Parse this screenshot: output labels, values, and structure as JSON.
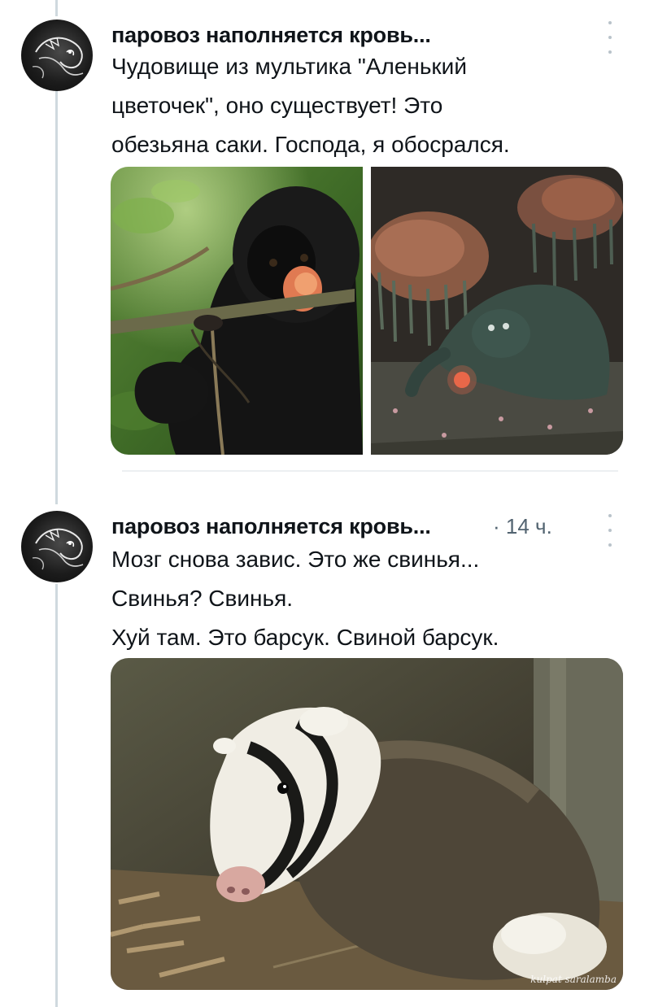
{
  "tweets": [
    {
      "author": "паровоз наполняется кровь...",
      "time": "",
      "text_lines": [
        "Чудовище из мультика \"Аленький",
        "цветочек\", оно существует! Это",
        "обезьяна саки. Господа, я обосрался."
      ],
      "media": [
        {
          "name": "photo-saki-monkey"
        },
        {
          "name": "still-cartoon-beast"
        }
      ]
    },
    {
      "author": "паровоз наполняется кровь...",
      "time": "· 14 ч.",
      "text_lines": [
        "Мозг снова завис. Это же свинья...",
        "Свинья? Свинья.",
        "Хуй там. Это барсук. Свиной барсук."
      ],
      "media": [
        {
          "name": "photo-hog-badger",
          "watermark": "kulpat  saralamba"
        }
      ]
    }
  ],
  "icons": [
    "more-options-icon",
    "avatar-dragon-drawing"
  ],
  "colors": {
    "text": "#0f1419",
    "secondary": "#536471",
    "thread_line": "#cfd9de"
  }
}
